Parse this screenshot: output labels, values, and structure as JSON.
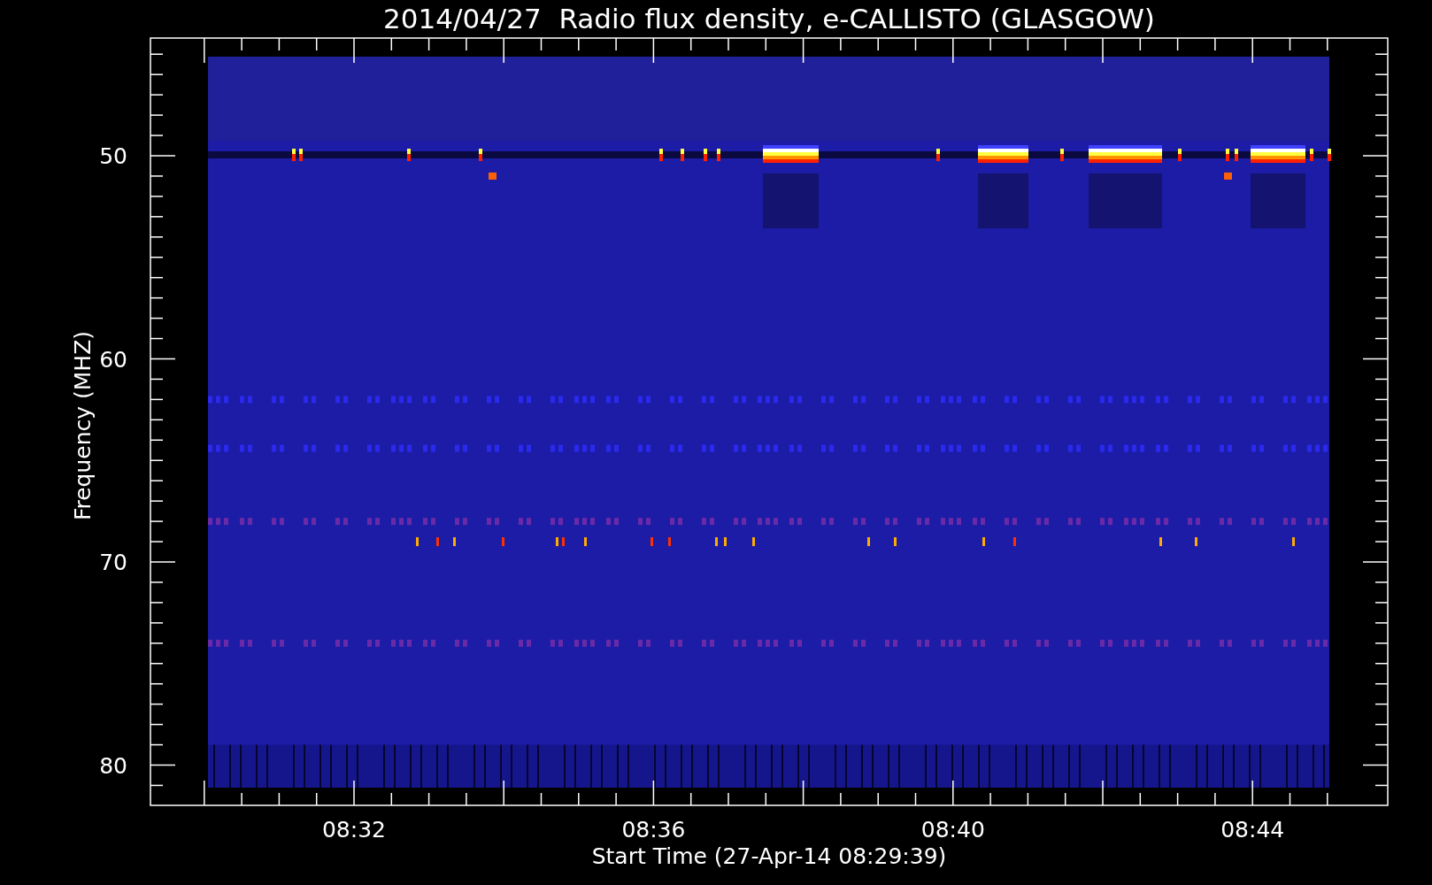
{
  "title": "2014/04/27  Radio flux density, e-CALLISTO (GLASGOW)",
  "y_axis": {
    "label": "Frequency (MHZ)",
    "ticks": [
      "50",
      "60",
      "70",
      "80"
    ]
  },
  "x_axis": {
    "label": "Start Time (27-Apr-14 08:29:39)",
    "ticks": [
      "08:32",
      "08:36",
      "08:40",
      "08:44"
    ]
  }
}
